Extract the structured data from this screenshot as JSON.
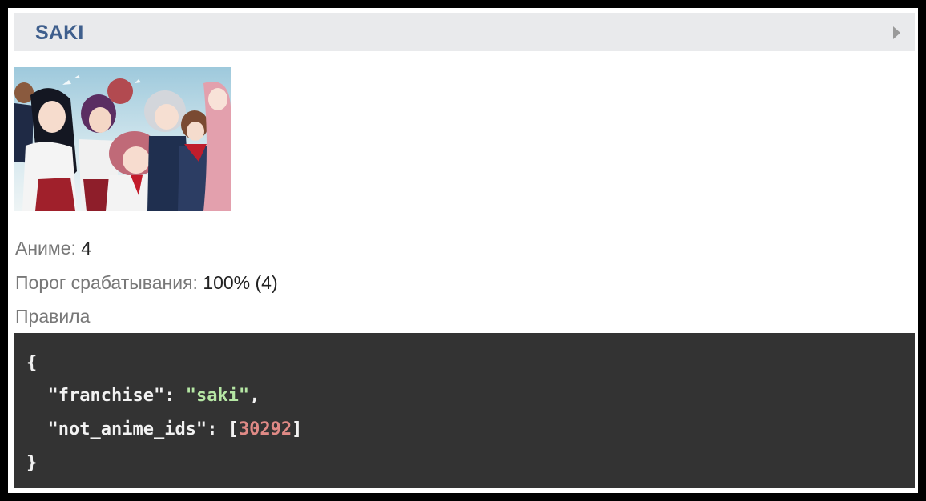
{
  "header": {
    "title": "SAKI",
    "expand_icon": "triangle-right-icon"
  },
  "poster": {
    "description_icon": "anime-group-poster"
  },
  "meta": {
    "anime_label": "Аниме:",
    "anime_value": "4",
    "threshold_label": "Порог срабатывания:",
    "threshold_value": "100% (4)",
    "rules_label": "Правила"
  },
  "rules_code": {
    "open_brace": "{",
    "franchise_key": "\"franchise\"",
    "franchise_value": "\"saki\"",
    "not_anime_ids_key": "\"not_anime_ids\"",
    "not_anime_ids_value": "30292",
    "close_brace": "}"
  },
  "colors": {
    "header_bg": "#e9eaec",
    "header_title": "#3f5f8d",
    "code_bg": "#333333",
    "code_string": "#b5e6a4",
    "code_number": "#e08a86"
  }
}
